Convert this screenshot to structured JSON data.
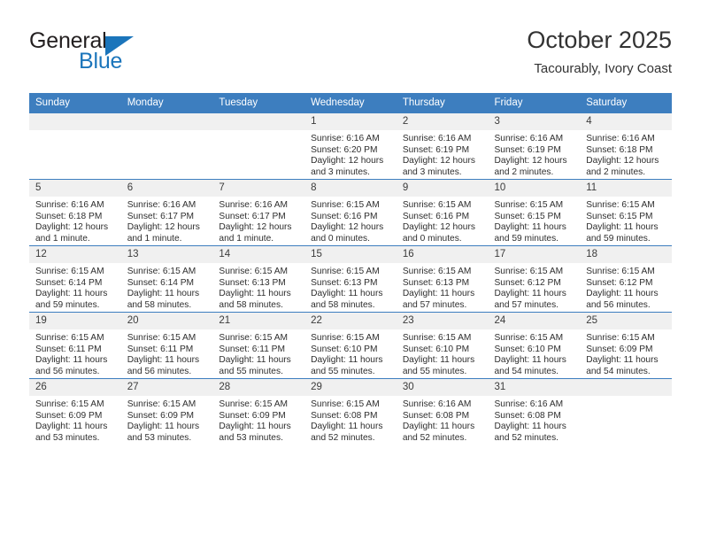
{
  "brand": {
    "name_top": "General",
    "name_bottom": "Blue",
    "accent_color": "#1b75bb",
    "triangle_icon": "triangle-icon"
  },
  "header": {
    "title": "October 2025",
    "subtitle": "Tacourably, Ivory Coast"
  },
  "theme": {
    "header_blue": "#3d7ebf",
    "daynum_band": "#f0f0f0",
    "text": "#2e2e2e"
  },
  "weekday_headers": [
    "Sunday",
    "Monday",
    "Tuesday",
    "Wednesday",
    "Thursday",
    "Friday",
    "Saturday"
  ],
  "weeks": [
    [
      {
        "day": "",
        "sunrise": "",
        "sunset": "",
        "daylight1": "",
        "daylight2": ""
      },
      {
        "day": "",
        "sunrise": "",
        "sunset": "",
        "daylight1": "",
        "daylight2": ""
      },
      {
        "day": "",
        "sunrise": "",
        "sunset": "",
        "daylight1": "",
        "daylight2": ""
      },
      {
        "day": "1",
        "sunrise": "Sunrise: 6:16 AM",
        "sunset": "Sunset: 6:20 PM",
        "daylight1": "Daylight: 12 hours",
        "daylight2": "and 3 minutes."
      },
      {
        "day": "2",
        "sunrise": "Sunrise: 6:16 AM",
        "sunset": "Sunset: 6:19 PM",
        "daylight1": "Daylight: 12 hours",
        "daylight2": "and 3 minutes."
      },
      {
        "day": "3",
        "sunrise": "Sunrise: 6:16 AM",
        "sunset": "Sunset: 6:19 PM",
        "daylight1": "Daylight: 12 hours",
        "daylight2": "and 2 minutes."
      },
      {
        "day": "4",
        "sunrise": "Sunrise: 6:16 AM",
        "sunset": "Sunset: 6:18 PM",
        "daylight1": "Daylight: 12 hours",
        "daylight2": "and 2 minutes."
      }
    ],
    [
      {
        "day": "5",
        "sunrise": "Sunrise: 6:16 AM",
        "sunset": "Sunset: 6:18 PM",
        "daylight1": "Daylight: 12 hours",
        "daylight2": "and 1 minute."
      },
      {
        "day": "6",
        "sunrise": "Sunrise: 6:16 AM",
        "sunset": "Sunset: 6:17 PM",
        "daylight1": "Daylight: 12 hours",
        "daylight2": "and 1 minute."
      },
      {
        "day": "7",
        "sunrise": "Sunrise: 6:16 AM",
        "sunset": "Sunset: 6:17 PM",
        "daylight1": "Daylight: 12 hours",
        "daylight2": "and 1 minute."
      },
      {
        "day": "8",
        "sunrise": "Sunrise: 6:15 AM",
        "sunset": "Sunset: 6:16 PM",
        "daylight1": "Daylight: 12 hours",
        "daylight2": "and 0 minutes."
      },
      {
        "day": "9",
        "sunrise": "Sunrise: 6:15 AM",
        "sunset": "Sunset: 6:16 PM",
        "daylight1": "Daylight: 12 hours",
        "daylight2": "and 0 minutes."
      },
      {
        "day": "10",
        "sunrise": "Sunrise: 6:15 AM",
        "sunset": "Sunset: 6:15 PM",
        "daylight1": "Daylight: 11 hours",
        "daylight2": "and 59 minutes."
      },
      {
        "day": "11",
        "sunrise": "Sunrise: 6:15 AM",
        "sunset": "Sunset: 6:15 PM",
        "daylight1": "Daylight: 11 hours",
        "daylight2": "and 59 minutes."
      }
    ],
    [
      {
        "day": "12",
        "sunrise": "Sunrise: 6:15 AM",
        "sunset": "Sunset: 6:14 PM",
        "daylight1": "Daylight: 11 hours",
        "daylight2": "and 59 minutes."
      },
      {
        "day": "13",
        "sunrise": "Sunrise: 6:15 AM",
        "sunset": "Sunset: 6:14 PM",
        "daylight1": "Daylight: 11 hours",
        "daylight2": "and 58 minutes."
      },
      {
        "day": "14",
        "sunrise": "Sunrise: 6:15 AM",
        "sunset": "Sunset: 6:13 PM",
        "daylight1": "Daylight: 11 hours",
        "daylight2": "and 58 minutes."
      },
      {
        "day": "15",
        "sunrise": "Sunrise: 6:15 AM",
        "sunset": "Sunset: 6:13 PM",
        "daylight1": "Daylight: 11 hours",
        "daylight2": "and 58 minutes."
      },
      {
        "day": "16",
        "sunrise": "Sunrise: 6:15 AM",
        "sunset": "Sunset: 6:13 PM",
        "daylight1": "Daylight: 11 hours",
        "daylight2": "and 57 minutes."
      },
      {
        "day": "17",
        "sunrise": "Sunrise: 6:15 AM",
        "sunset": "Sunset: 6:12 PM",
        "daylight1": "Daylight: 11 hours",
        "daylight2": "and 57 minutes."
      },
      {
        "day": "18",
        "sunrise": "Sunrise: 6:15 AM",
        "sunset": "Sunset: 6:12 PM",
        "daylight1": "Daylight: 11 hours",
        "daylight2": "and 56 minutes."
      }
    ],
    [
      {
        "day": "19",
        "sunrise": "Sunrise: 6:15 AM",
        "sunset": "Sunset: 6:11 PM",
        "daylight1": "Daylight: 11 hours",
        "daylight2": "and 56 minutes."
      },
      {
        "day": "20",
        "sunrise": "Sunrise: 6:15 AM",
        "sunset": "Sunset: 6:11 PM",
        "daylight1": "Daylight: 11 hours",
        "daylight2": "and 56 minutes."
      },
      {
        "day": "21",
        "sunrise": "Sunrise: 6:15 AM",
        "sunset": "Sunset: 6:11 PM",
        "daylight1": "Daylight: 11 hours",
        "daylight2": "and 55 minutes."
      },
      {
        "day": "22",
        "sunrise": "Sunrise: 6:15 AM",
        "sunset": "Sunset: 6:10 PM",
        "daylight1": "Daylight: 11 hours",
        "daylight2": "and 55 minutes."
      },
      {
        "day": "23",
        "sunrise": "Sunrise: 6:15 AM",
        "sunset": "Sunset: 6:10 PM",
        "daylight1": "Daylight: 11 hours",
        "daylight2": "and 55 minutes."
      },
      {
        "day": "24",
        "sunrise": "Sunrise: 6:15 AM",
        "sunset": "Sunset: 6:10 PM",
        "daylight1": "Daylight: 11 hours",
        "daylight2": "and 54 minutes."
      },
      {
        "day": "25",
        "sunrise": "Sunrise: 6:15 AM",
        "sunset": "Sunset: 6:09 PM",
        "daylight1": "Daylight: 11 hours",
        "daylight2": "and 54 minutes."
      }
    ],
    [
      {
        "day": "26",
        "sunrise": "Sunrise: 6:15 AM",
        "sunset": "Sunset: 6:09 PM",
        "daylight1": "Daylight: 11 hours",
        "daylight2": "and 53 minutes."
      },
      {
        "day": "27",
        "sunrise": "Sunrise: 6:15 AM",
        "sunset": "Sunset: 6:09 PM",
        "daylight1": "Daylight: 11 hours",
        "daylight2": "and 53 minutes."
      },
      {
        "day": "28",
        "sunrise": "Sunrise: 6:15 AM",
        "sunset": "Sunset: 6:09 PM",
        "daylight1": "Daylight: 11 hours",
        "daylight2": "and 53 minutes."
      },
      {
        "day": "29",
        "sunrise": "Sunrise: 6:15 AM",
        "sunset": "Sunset: 6:08 PM",
        "daylight1": "Daylight: 11 hours",
        "daylight2": "and 52 minutes."
      },
      {
        "day": "30",
        "sunrise": "Sunrise: 6:16 AM",
        "sunset": "Sunset: 6:08 PM",
        "daylight1": "Daylight: 11 hours",
        "daylight2": "and 52 minutes."
      },
      {
        "day": "31",
        "sunrise": "Sunrise: 6:16 AM",
        "sunset": "Sunset: 6:08 PM",
        "daylight1": "Daylight: 11 hours",
        "daylight2": "and 52 minutes."
      },
      {
        "day": "",
        "sunrise": "",
        "sunset": "",
        "daylight1": "",
        "daylight2": ""
      }
    ]
  ]
}
